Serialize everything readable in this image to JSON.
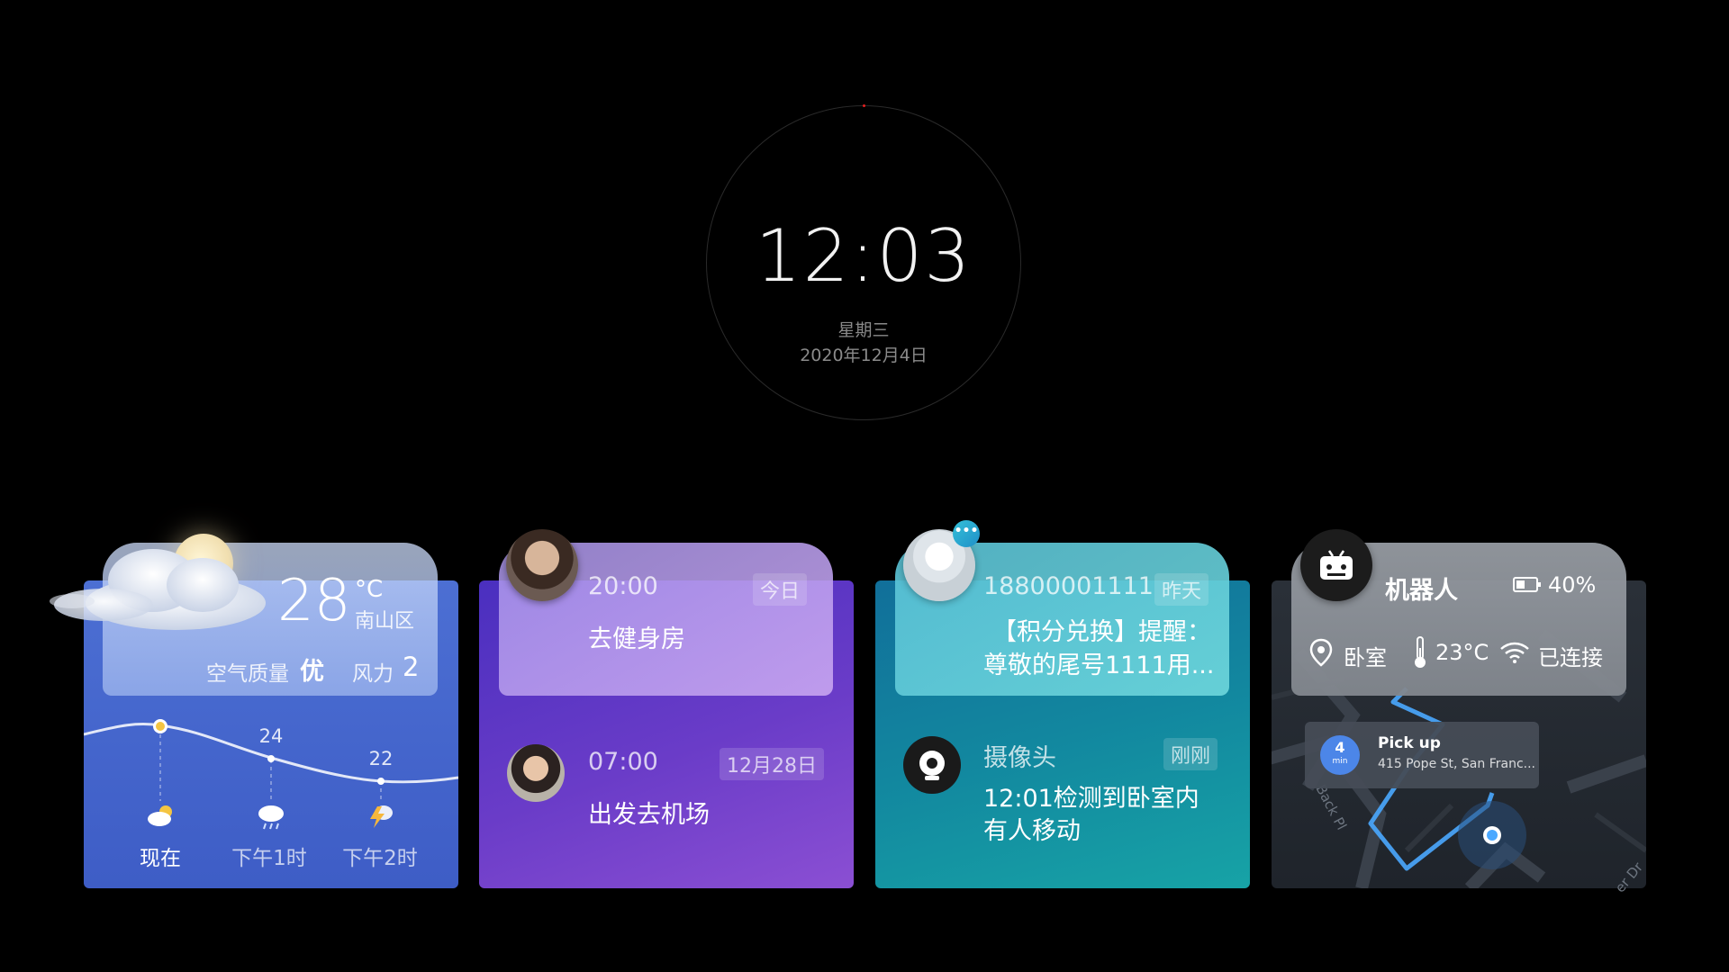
{
  "clock": {
    "time": "12:03",
    "weekday": "星期三",
    "date": "2020年12月4日"
  },
  "weather": {
    "temperature": "28",
    "unit": "°C",
    "district": "南山区",
    "air_quality_label": "空气质量",
    "air_quality_value": "优",
    "wind_label": "风力",
    "wind_value": "2",
    "forecast": [
      {
        "label": "现在",
        "temp": "",
        "icon": "partly-cloudy-icon"
      },
      {
        "label": "下午1时",
        "temp": "24",
        "icon": "rain-cloud-icon"
      },
      {
        "label": "下午2时",
        "temp": "22",
        "icon": "thunder-icon"
      }
    ]
  },
  "schedule": {
    "items": [
      {
        "time": "20:00",
        "tag": "今日",
        "title": "去健身房"
      },
      {
        "time": "07:00",
        "tag": "12月28日",
        "title": "出发去机场"
      }
    ]
  },
  "messages": {
    "sms": {
      "sender": "18800001111",
      "tag": "昨天",
      "line1": "【积分兑换】提醒：",
      "line2": "尊敬的尾号1111用..."
    },
    "camera": {
      "title": "摄像头",
      "tag": "刚刚",
      "line1": "12:01检测到卧室内",
      "line2": "有人移动"
    }
  },
  "robot": {
    "name": "机器人",
    "battery": "40%",
    "location": "卧室",
    "temperature": "23°C",
    "wifi": "已连接",
    "map": {
      "pickup_title": "Pick up",
      "pickup_address": "415 Pope St, San Franc...",
      "eta_number": "4",
      "eta_unit": "min",
      "street1": "Back Pl",
      "street2": "er Dr"
    }
  },
  "colors": {
    "weather": "#4466cc",
    "schedule": "#6a3cc8",
    "messages": "#12879f",
    "robot": "#23282f",
    "accent_blue": "#4aa8ff"
  }
}
